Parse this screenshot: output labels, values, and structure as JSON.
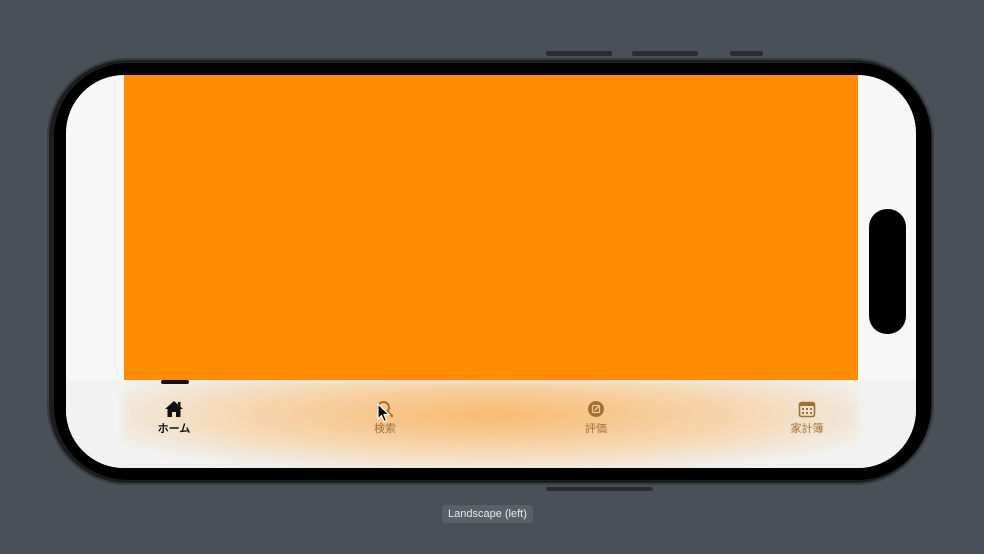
{
  "tabbar": {
    "tabs": [
      {
        "label": "ホーム",
        "icon": "home-icon",
        "active": true
      },
      {
        "label": "検索",
        "icon": "search-icon",
        "active": false
      },
      {
        "label": "評価",
        "icon": "edit-circle-icon",
        "active": false
      },
      {
        "label": "家計簿",
        "icon": "calendar-icon",
        "active": false
      }
    ]
  },
  "simulator": {
    "orientation_label": "Landscape (left)"
  },
  "colors": {
    "content_background": "#ff8c00",
    "tab_inactive": "#a0703a",
    "tab_active": "#111111",
    "screen_background": "#f7f7f7",
    "desktop_background": "#4a5058"
  }
}
